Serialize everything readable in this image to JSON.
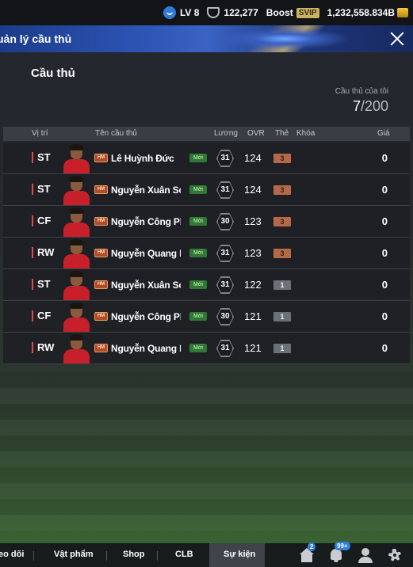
{
  "topbar": {
    "level": "LV 8",
    "trophies": "122,277",
    "boost_label": "Boost",
    "svip_label": "SVIP",
    "currency": "1,232,558.834B"
  },
  "header": {
    "title": "uản lý cầu thủ"
  },
  "panel": {
    "title": "Cầu thủ",
    "my_players_label": "Cầu thủ của tôi",
    "my_players_count": "7",
    "my_players_total": "/200"
  },
  "table": {
    "columns": {
      "position": "Vị trí",
      "name": "Tên cầu thủ",
      "salary": "Lương",
      "ovr": "OVR",
      "card": "Thẻ",
      "lock": "Khóa",
      "price": "Giá"
    },
    "rows": [
      {
        "position": "ST",
        "season": "HM",
        "name": "Lê Huỳnh Đức",
        "new": "Mới",
        "salary": "31",
        "ovr": "124",
        "grade": "3",
        "grade_style": "bronze",
        "price": "0"
      },
      {
        "position": "ST",
        "season": "HM",
        "name": "Nguyễn Xuân Son",
        "new": "Mới",
        "salary": "31",
        "ovr": "124",
        "grade": "3",
        "grade_style": "bronze",
        "price": "0"
      },
      {
        "position": "CF",
        "season": "HM",
        "name": "Nguyễn Công Phư",
        "new": "Mới",
        "salary": "30",
        "ovr": "123",
        "grade": "3",
        "grade_style": "bronze",
        "price": "0"
      },
      {
        "position": "RW",
        "season": "HM",
        "name": "Nguyễn Quang Hả",
        "new": "Mới",
        "salary": "31",
        "ovr": "123",
        "grade": "3",
        "grade_style": "bronze",
        "price": "0"
      },
      {
        "position": "ST",
        "season": "HM",
        "name": "Nguyễn Xuân Son",
        "new": "Mới",
        "salary": "31",
        "ovr": "122",
        "grade": "1",
        "grade_style": "plain",
        "price": "0"
      },
      {
        "position": "CF",
        "season": "HM",
        "name": "Nguyễn Công Phư",
        "new": "Mới",
        "salary": "30",
        "ovr": "121",
        "grade": "1",
        "grade_style": "plain",
        "price": "0"
      },
      {
        "position": "RW",
        "season": "HM",
        "name": "Nguyễn Quang Hả",
        "new": "Mới",
        "salary": "31",
        "ovr": "121",
        "grade": "1",
        "grade_style": "plain",
        "price": "0"
      }
    ]
  },
  "bottom_nav": {
    "items": [
      "eo dõi",
      "Vật phẩm",
      "Shop",
      "CLB",
      "Sự kiện"
    ],
    "active": "Sự kiện",
    "home_badge": "2",
    "bell_badge": "99+"
  },
  "colors": {
    "header_blue": "#2d55b5",
    "position_marker": "#e34848",
    "new_badge": "#2f7a33",
    "grade_bronze": "#b46a48"
  }
}
